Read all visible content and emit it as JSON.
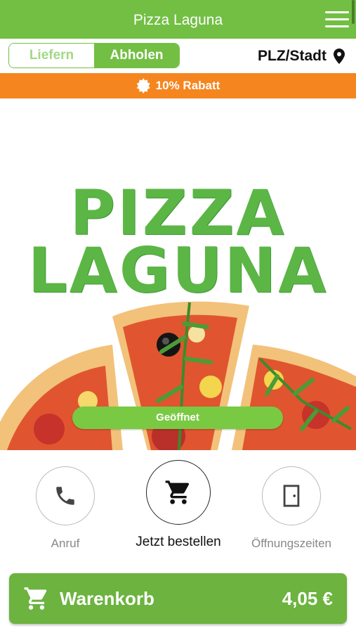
{
  "header": {
    "title": "Pizza Laguna"
  },
  "order_mode": {
    "delivery_label": "Liefern",
    "pickup_label": "Abholen",
    "selected": "pickup"
  },
  "location": {
    "label": "PLZ/Stadt"
  },
  "promo": {
    "text": "10% Rabatt"
  },
  "hero": {
    "brand_line1": "PIZZA",
    "brand_line2": "LAGUNA",
    "status_label": "Geöffnet"
  },
  "actions": {
    "call_label": "Anruf",
    "order_label": "Jetzt bestellen",
    "hours_label": "Öffnungszeiten"
  },
  "cart": {
    "label": "Warenkorb",
    "total": "4,05 €"
  },
  "colors": {
    "brand_green": "#72bf44",
    "promo_orange": "#f5851f",
    "cart_green": "#6cb33f"
  },
  "icons": [
    "menu-icon",
    "location-pin-icon",
    "badge-icon",
    "phone-icon",
    "cart-icon",
    "door-icon"
  ]
}
